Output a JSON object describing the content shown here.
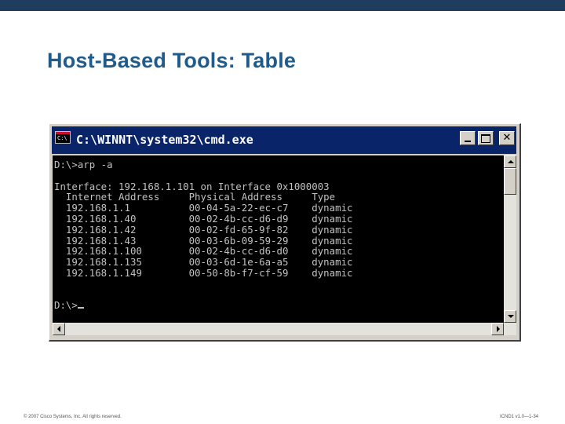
{
  "slide": {
    "title": "Host-Based Tools: Table",
    "footer_left": "© 2007 Cisco Systems, Inc. All rights reserved.",
    "footer_right": "ICND1 v1.0—1-34"
  },
  "window": {
    "title": "C:\\WINNT\\system32\\cmd.exe",
    "icon": "cmd-icon",
    "buttons": [
      "minimize",
      "maximize",
      "close"
    ]
  },
  "console": {
    "prompt_command": "D:\\>arp -a",
    "interface_line": "Interface: 192.168.1.101 on Interface 0x1000003",
    "headers": [
      "Internet Address",
      "Physical Address",
      "Type"
    ],
    "rows": [
      [
        "192.168.1.1",
        "00-04-5a-22-ec-c7",
        "dynamic"
      ],
      [
        "192.168.1.40",
        "00-02-4b-cc-d6-d9",
        "dynamic"
      ],
      [
        "192.168.1.42",
        "00-02-fd-65-9f-82",
        "dynamic"
      ],
      [
        "192.168.1.43",
        "00-03-6b-09-59-29",
        "dynamic"
      ],
      [
        "192.168.1.100",
        "00-02-4b-cc-d6-d0",
        "dynamic"
      ],
      [
        "192.168.1.135",
        "00-03-6d-1e-6a-a5",
        "dynamic"
      ],
      [
        "192.168.1.149",
        "00-50-8b-f7-cf-59",
        "dynamic"
      ]
    ],
    "final_prompt": "D:\\>"
  },
  "colors": {
    "top_bar": "#1f3e5e",
    "title_text": "#1f5c8c",
    "titlebar": "#0a246a",
    "console_bg": "#000000",
    "console_text": "#c0c0c0"
  }
}
